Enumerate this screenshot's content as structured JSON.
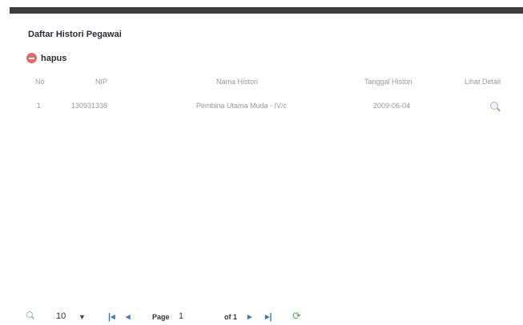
{
  "window": {
    "title": "Daftar Histori Pegawai"
  },
  "toolbar": {
    "hapus_label": "hapus",
    "hapus_icon": "delete-icon"
  },
  "table": {
    "headers": [
      "No",
      "NIP",
      "Nama Histori",
      "Tanggal Histori",
      "Lihat Detail"
    ],
    "rows": [
      {
        "no": "1",
        "nip": "130931338",
        "nama": "Pembina Utama Muda - IV/c",
        "tanggal": "2009-06-04",
        "detail_icon": "magnifier-icon"
      }
    ]
  },
  "pager": {
    "page_size": "10",
    "page_label": "Page",
    "page_value": "1",
    "of_label": "of 1",
    "first_icon": "first-page-icon",
    "prev_icon": "prev-page-icon",
    "next_icon": "next-page-icon",
    "last_icon": "last-page-icon",
    "refresh_icon": "refresh-icon"
  },
  "colors": {
    "topbar": "#3d3d3d",
    "hapus": "#e76a6a",
    "pager_buttons": "#3e78c4",
    "refresh": "#4caf50"
  }
}
